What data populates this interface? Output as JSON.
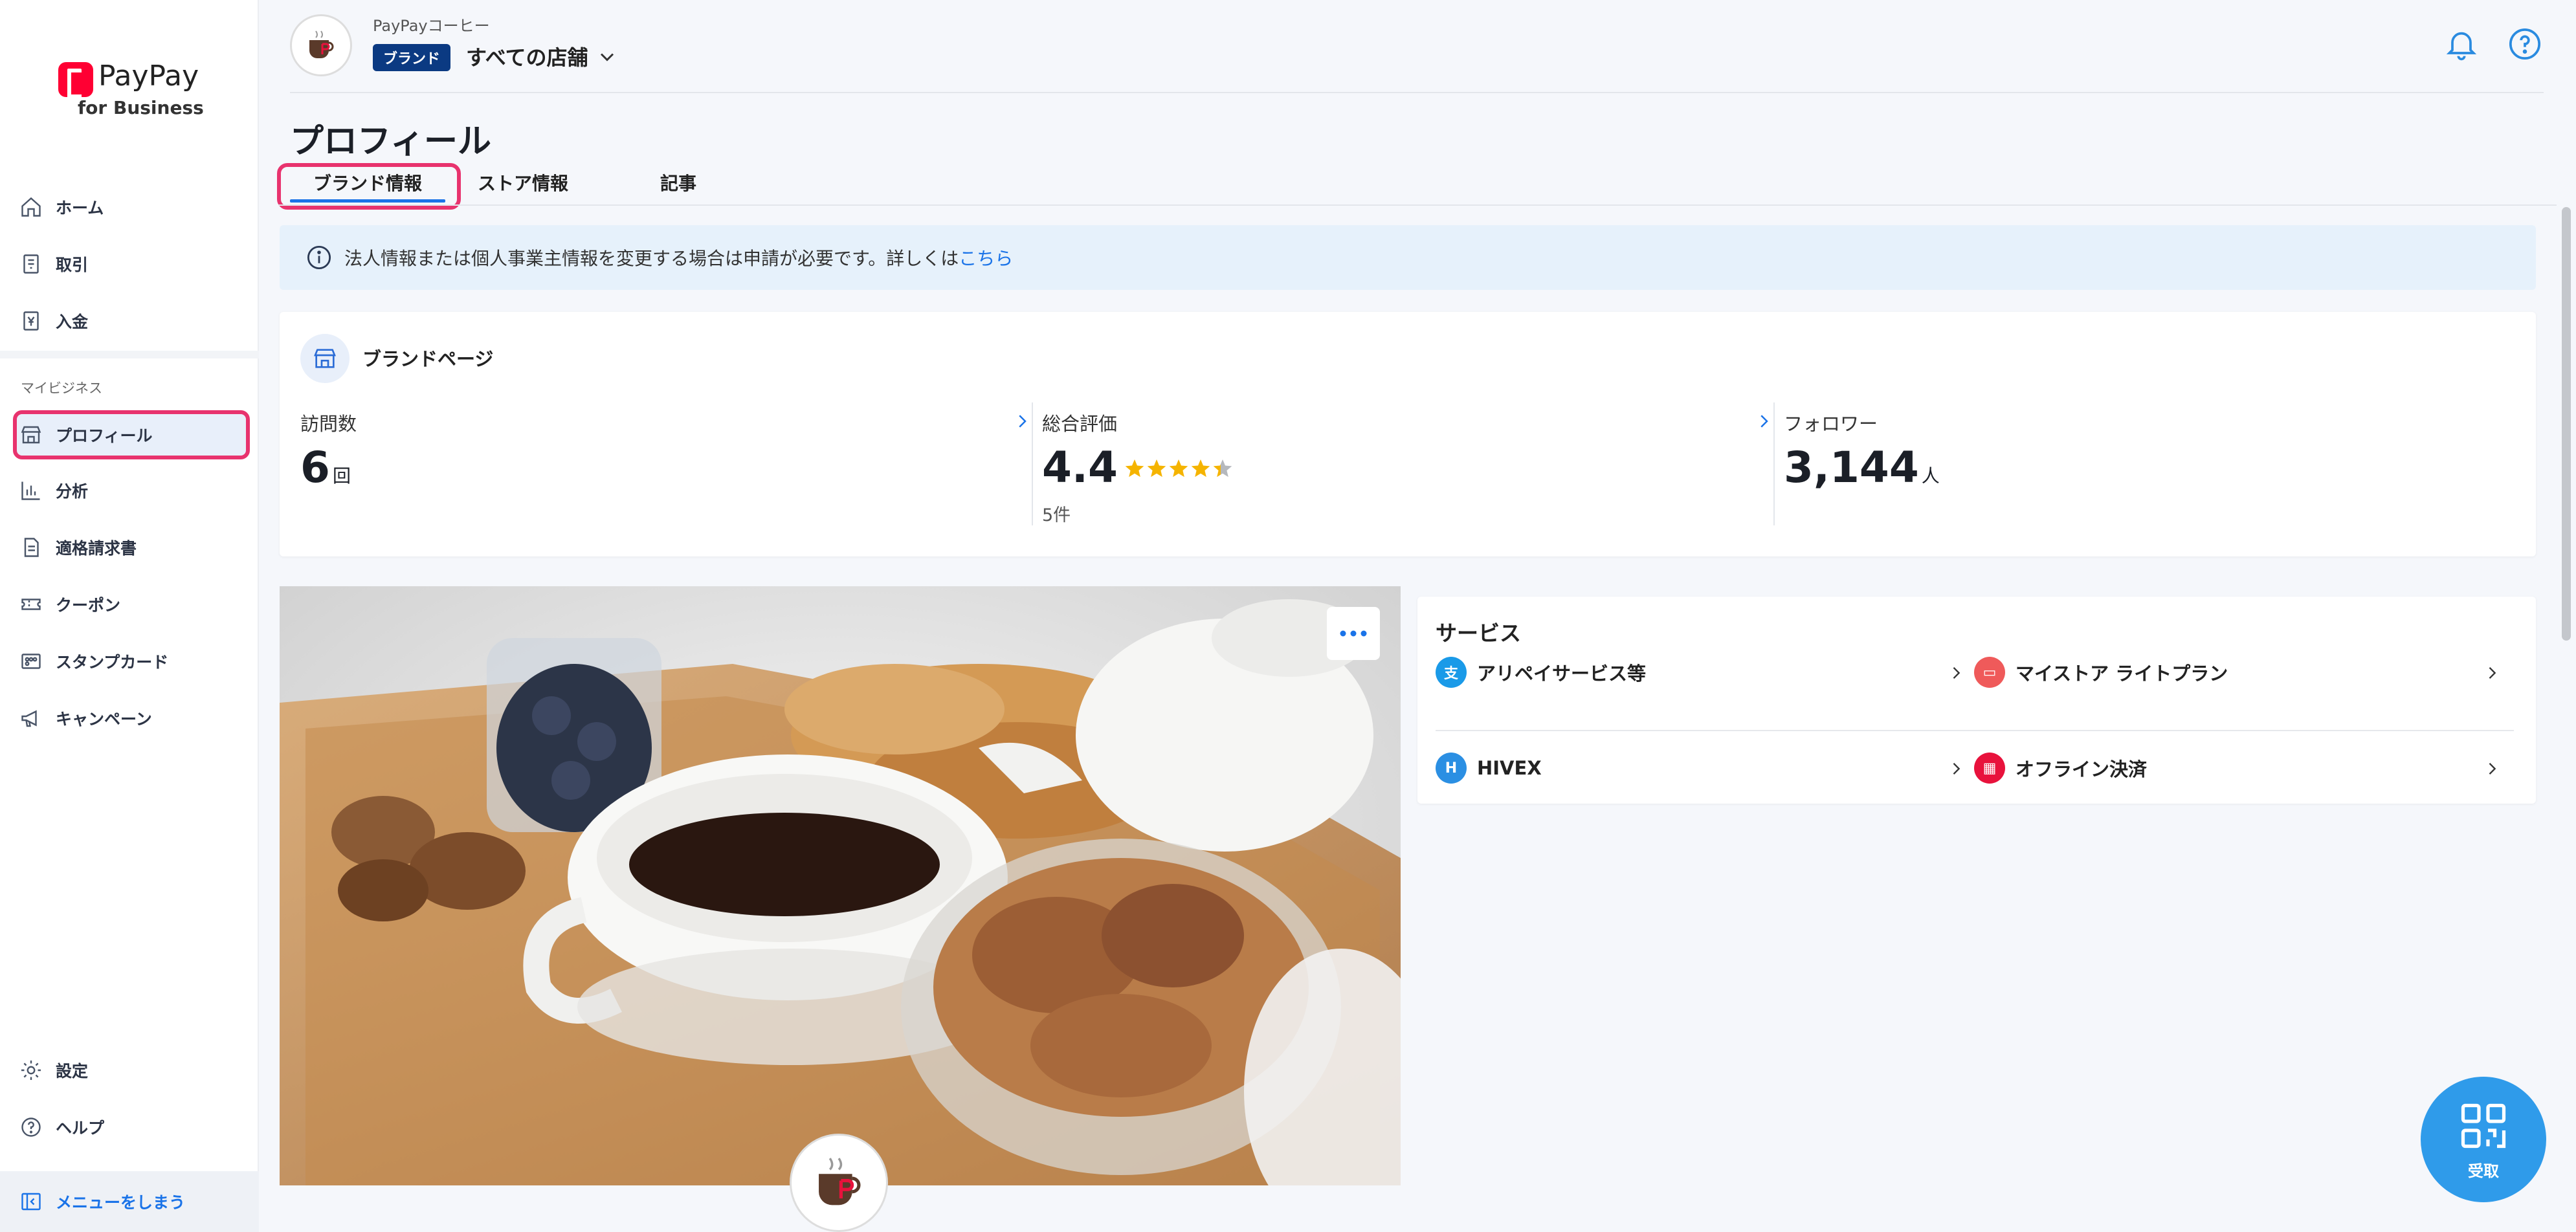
{
  "logo": {
    "text": "PayPay",
    "sub": "for Business"
  },
  "sidebar": {
    "items_top": [
      {
        "label": "ホーム",
        "icon": "home-icon"
      },
      {
        "label": "取引",
        "icon": "receipt-icon"
      },
      {
        "label": "入金",
        "icon": "deposit-icon"
      }
    ],
    "section_label": "マイビジネス",
    "items_business": [
      {
        "label": "プロフィール",
        "icon": "store-icon",
        "active": true
      },
      {
        "label": "分析",
        "icon": "chart-icon"
      },
      {
        "label": "適格請求書",
        "icon": "document-icon"
      },
      {
        "label": "クーポン",
        "icon": "coupon-icon"
      },
      {
        "label": "スタンプカード",
        "icon": "stamp-card-icon"
      },
      {
        "label": "キャンペーン",
        "icon": "megaphone-icon"
      }
    ],
    "items_bottom": [
      {
        "label": "設定",
        "icon": "gear-icon"
      },
      {
        "label": "ヘルプ",
        "icon": "help-icon"
      }
    ],
    "collapse_label": "メニューをしまう"
  },
  "header": {
    "shop_name": "PayPayコーヒー",
    "badge": "ブランド",
    "store_selector": "すべての店舗"
  },
  "page": {
    "title": "プロフィール",
    "tabs": [
      {
        "label": "ブランド情報",
        "active": true
      },
      {
        "label": "ストア情報"
      },
      {
        "label": "記事"
      }
    ]
  },
  "info_banner": {
    "text": "法人情報または個人事業主情報を変更する場合は申請が必要です。詳しくは",
    "link": "こちら"
  },
  "brand_page": {
    "title": "ブランドページ",
    "visits": {
      "label": "訪問数",
      "value": "6",
      "unit": "回"
    },
    "rating": {
      "label": "総合評価",
      "value": "4.4",
      "count": "5件",
      "stars": 4.4
    },
    "followers": {
      "label": "フォロワー",
      "value": "3,144",
      "unit": "人"
    }
  },
  "services": {
    "title": "サービス",
    "items": [
      {
        "label": "アリペイサービス等",
        "icon": "alipay-icon",
        "color": "#1a9ae8"
      },
      {
        "label": "マイストア ライトプラン",
        "icon": "mystore-icon",
        "color": "#ef5a5a"
      },
      {
        "label": "HIVEX",
        "icon": "hivex-icon",
        "color": "#2b8fe3"
      },
      {
        "label": "オフライン決済",
        "icon": "offline-payment-icon",
        "color": "#e8123c"
      }
    ]
  },
  "fab": {
    "label": "受取"
  },
  "colors": {
    "accent": "#1a73e8",
    "highlight": "#e8336e",
    "badge": "#0b3a82",
    "fab": "#2f9bea"
  }
}
